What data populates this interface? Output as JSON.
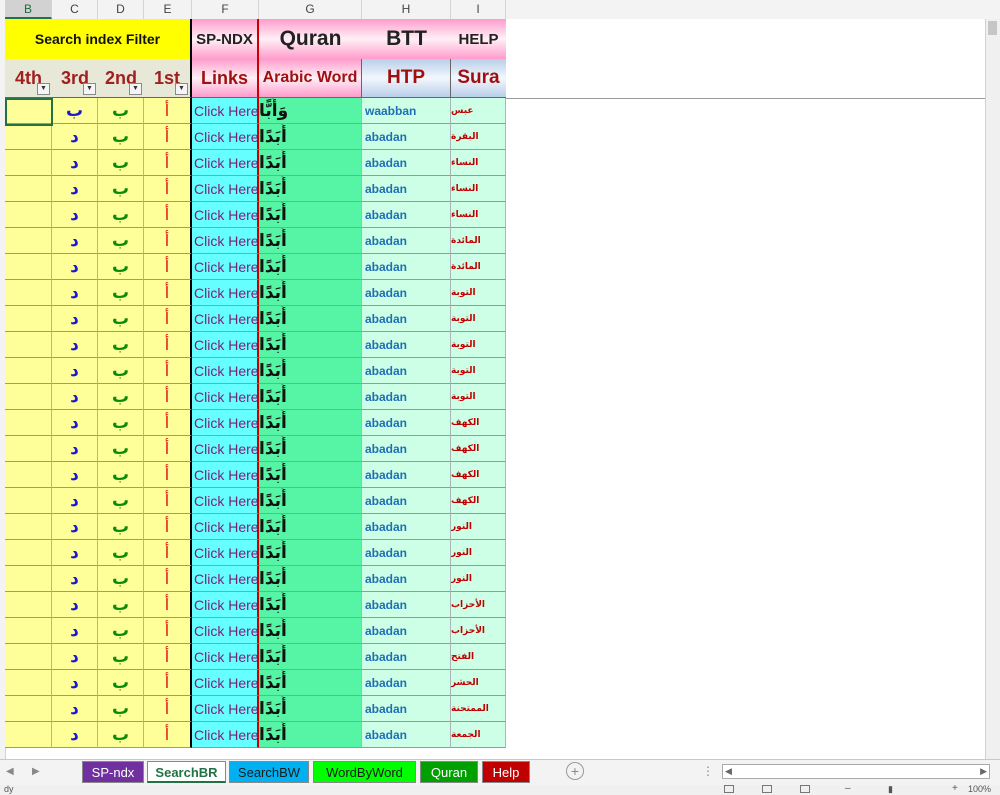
{
  "columns": [
    "B",
    "C",
    "D",
    "E",
    "F",
    "G",
    "H",
    "I"
  ],
  "header": {
    "search_filter": "Search index Filter",
    "sp_ndx": "SP-NDX",
    "quran": "Quran",
    "btt": "BTT",
    "help": "HELP",
    "col_4th": "4th",
    "col_3rd": "3rd",
    "col_2nd": "2nd",
    "col_1st": "1st",
    "links": "Links",
    "arabic_word": "Arabic Word",
    "htp": "HTP",
    "sura": "Sura"
  },
  "rows": [
    {
      "c": "ب",
      "d": "ب",
      "e": "أ",
      "f": "Click Here",
      "g": "وَأَبًّا",
      "h": "waabban",
      "i": "عبس"
    },
    {
      "c": "د",
      "d": "ب",
      "e": "أ",
      "f": "Click Here",
      "g": "أَبَدًا",
      "h": "abadan",
      "i": "البقرة"
    },
    {
      "c": "د",
      "d": "ب",
      "e": "أ",
      "f": "Click Here",
      "g": "أَبَدًا",
      "h": "abadan",
      "i": "النساء"
    },
    {
      "c": "د",
      "d": "ب",
      "e": "أ",
      "f": "Click Here",
      "g": "أَبَدًا",
      "h": "abadan",
      "i": "النساء"
    },
    {
      "c": "د",
      "d": "ب",
      "e": "أ",
      "f": "Click Here",
      "g": "أَبَدًا",
      "h": "abadan",
      "i": "النساء"
    },
    {
      "c": "د",
      "d": "ب",
      "e": "أ",
      "f": "Click Here",
      "g": "أَبَدًا",
      "h": "abadan",
      "i": "المائدة"
    },
    {
      "c": "د",
      "d": "ب",
      "e": "أ",
      "f": "Click Here",
      "g": "أَبَدًا",
      "h": "abadan",
      "i": "المائدة"
    },
    {
      "c": "د",
      "d": "ب",
      "e": "أ",
      "f": "Click Here",
      "g": "أَبَدًا",
      "h": "abadan",
      "i": "التوبة"
    },
    {
      "c": "د",
      "d": "ب",
      "e": "أ",
      "f": "Click Here",
      "g": "أَبَدًا",
      "h": "abadan",
      "i": "التوبة"
    },
    {
      "c": "د",
      "d": "ب",
      "e": "أ",
      "f": "Click Here",
      "g": "أَبَدًا",
      "h": "abadan",
      "i": "التوبة"
    },
    {
      "c": "د",
      "d": "ب",
      "e": "أ",
      "f": "Click Here",
      "g": "أَبَدًا",
      "h": "abadan",
      "i": "التوبة"
    },
    {
      "c": "د",
      "d": "ب",
      "e": "أ",
      "f": "Click Here",
      "g": "أَبَدًا",
      "h": "abadan",
      "i": "التوبة"
    },
    {
      "c": "د",
      "d": "ب",
      "e": "أ",
      "f": "Click Here",
      "g": "أَبَدًا",
      "h": "abadan",
      "i": "الكهف"
    },
    {
      "c": "د",
      "d": "ب",
      "e": "أ",
      "f": "Click Here",
      "g": "أَبَدًا",
      "h": "abadan",
      "i": "الكهف"
    },
    {
      "c": "د",
      "d": "ب",
      "e": "أ",
      "f": "Click Here",
      "g": "أَبَدًا",
      "h": "abadan",
      "i": "الكهف"
    },
    {
      "c": "د",
      "d": "ب",
      "e": "أ",
      "f": "Click Here",
      "g": "أَبَدًا",
      "h": "abadan",
      "i": "الكهف"
    },
    {
      "c": "د",
      "d": "ب",
      "e": "أ",
      "f": "Click Here",
      "g": "أَبَدًا",
      "h": "abadan",
      "i": "النور"
    },
    {
      "c": "د",
      "d": "ب",
      "e": "أ",
      "f": "Click Here",
      "g": "أَبَدًا",
      "h": "abadan",
      "i": "النور"
    },
    {
      "c": "د",
      "d": "ب",
      "e": "أ",
      "f": "Click Here",
      "g": "أَبَدًا",
      "h": "abadan",
      "i": "النور"
    },
    {
      "c": "د",
      "d": "ب",
      "e": "أ",
      "f": "Click Here",
      "g": "أَبَدًا",
      "h": "abadan",
      "i": "الأحزاب"
    },
    {
      "c": "د",
      "d": "ب",
      "e": "أ",
      "f": "Click Here",
      "g": "أَبَدًا",
      "h": "abadan",
      "i": "الأحزاب"
    },
    {
      "c": "د",
      "d": "ب",
      "e": "أ",
      "f": "Click Here",
      "g": "أَبَدًا",
      "h": "abadan",
      "i": "الفتح"
    },
    {
      "c": "د",
      "d": "ب",
      "e": "أ",
      "f": "Click Here",
      "g": "أَبَدًا",
      "h": "abadan",
      "i": "الحشر"
    },
    {
      "c": "د",
      "d": "ب",
      "e": "أ",
      "f": "Click Here",
      "g": "أَبَدًا",
      "h": "abadan",
      "i": "الممتحنة"
    },
    {
      "c": "د",
      "d": "ب",
      "e": "أ",
      "f": "Click Here",
      "g": "أَبَدًا",
      "h": "abadan",
      "i": "الجمعة"
    }
  ],
  "sheet_tabs": [
    {
      "label": "SP-ndx",
      "bg": "#7030a0",
      "fg": "#ffffff"
    },
    {
      "label": "SearchBR",
      "bg": "#ffffff",
      "fg": "#217346",
      "active": true
    },
    {
      "label": "SearchBW",
      "bg": "#00b0f0",
      "fg": "#1a1a1a"
    },
    {
      "label": "WordByWord",
      "bg": "#00ff00",
      "fg": "#1a1a1a"
    },
    {
      "label": "Quran",
      "bg": "#00a000",
      "fg": "#ffffff"
    },
    {
      "label": "Help",
      "bg": "#c00000",
      "fg": "#ffffff"
    }
  ],
  "status": {
    "left": "dy",
    "zoom": "100%"
  },
  "colors": {
    "yellow": "#ffff99",
    "cyan": "#66ffff",
    "green": "#55f5a5",
    "mint": "#ccffe5",
    "pink": "#ff9ccc",
    "blue_header": "#b9cfe9"
  }
}
